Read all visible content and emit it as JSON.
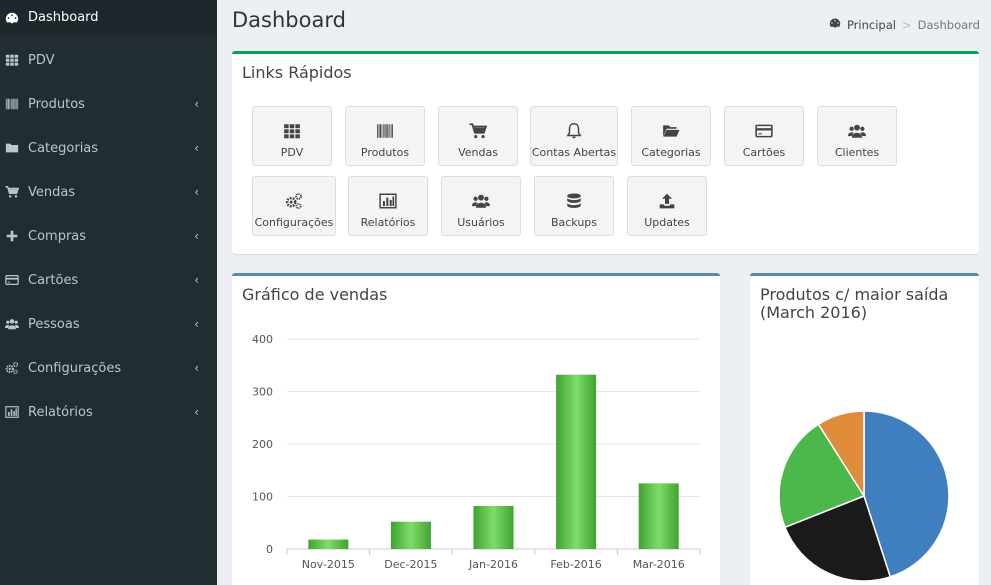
{
  "sidebar": {
    "items": [
      {
        "label": "Dashboard",
        "icon": "dashboard-icon",
        "active": true,
        "chevron": false
      },
      {
        "label": "PDV",
        "icon": "grid-icon",
        "active": false,
        "chevron": false
      },
      {
        "label": "Produtos",
        "icon": "barcode-icon",
        "active": false,
        "chevron": true
      },
      {
        "label": "Categorias",
        "icon": "folder-icon",
        "active": false,
        "chevron": true
      },
      {
        "label": "Vendas",
        "icon": "cart-icon",
        "active": false,
        "chevron": true
      },
      {
        "label": "Compras",
        "icon": "plus-icon",
        "active": false,
        "chevron": true
      },
      {
        "label": "Cartões",
        "icon": "credit-card-icon",
        "active": false,
        "chevron": true
      },
      {
        "label": "Pessoas",
        "icon": "users-icon",
        "active": false,
        "chevron": true
      },
      {
        "label": "Configurações",
        "icon": "cogs-icon",
        "active": false,
        "chevron": true
      },
      {
        "label": "Relatórios",
        "icon": "bar-chart-icon",
        "active": false,
        "chevron": true
      }
    ],
    "chevron_glyph": "‹"
  },
  "header": {
    "title": "Dashboard",
    "breadcrumb": {
      "home": "Principal",
      "separator": ">",
      "current": "Dashboard"
    }
  },
  "quick_links": {
    "title": "Links Rápidos",
    "items": [
      {
        "label": "PDV",
        "icon": "grid-icon"
      },
      {
        "label": "Produtos",
        "icon": "barcode-icon"
      },
      {
        "label": "Vendas",
        "icon": "cart-icon"
      },
      {
        "label": "Contas Abertas",
        "icon": "bell-icon"
      },
      {
        "label": "Categorias",
        "icon": "folder-open-icon"
      },
      {
        "label": "Cartões",
        "icon": "credit-card-icon"
      },
      {
        "label": "Clientes",
        "icon": "users-icon"
      },
      {
        "label": "Configurações",
        "icon": "cogs-icon"
      },
      {
        "label": "Relatórios",
        "icon": "bar-chart-icon"
      },
      {
        "label": "Usuários",
        "icon": "users-icon"
      },
      {
        "label": "Backups",
        "icon": "database-icon"
      },
      {
        "label": "Updates",
        "icon": "upload-icon"
      }
    ]
  },
  "sales_chart": {
    "title": "Gráfico de vendas",
    "chart_data": {
      "type": "bar",
      "categories": [
        "Nov-2015",
        "Dec-2015",
        "Jan-2016",
        "Feb-2016",
        "Mar-2016"
      ],
      "values": [
        18,
        52,
        82,
        332,
        125
      ],
      "ylim": [
        0,
        400
      ],
      "yticks": [
        0,
        100,
        200,
        300,
        400
      ],
      "grid": true,
      "bar_color": "#4cbb3c"
    }
  },
  "top_products": {
    "title": "Produtos c/ maior saída (March 2016)",
    "chart_data": {
      "type": "pie",
      "values": [
        45,
        24,
        22,
        9
      ],
      "colors": [
        "#3f7fbf",
        "#1a1a1a",
        "#4cb84c",
        "#e08c3a"
      ]
    }
  },
  "colors": {
    "sidebar_bg": "#222d32",
    "accent_green": "#00a65a",
    "accent_blue": "#5b8aa8"
  }
}
